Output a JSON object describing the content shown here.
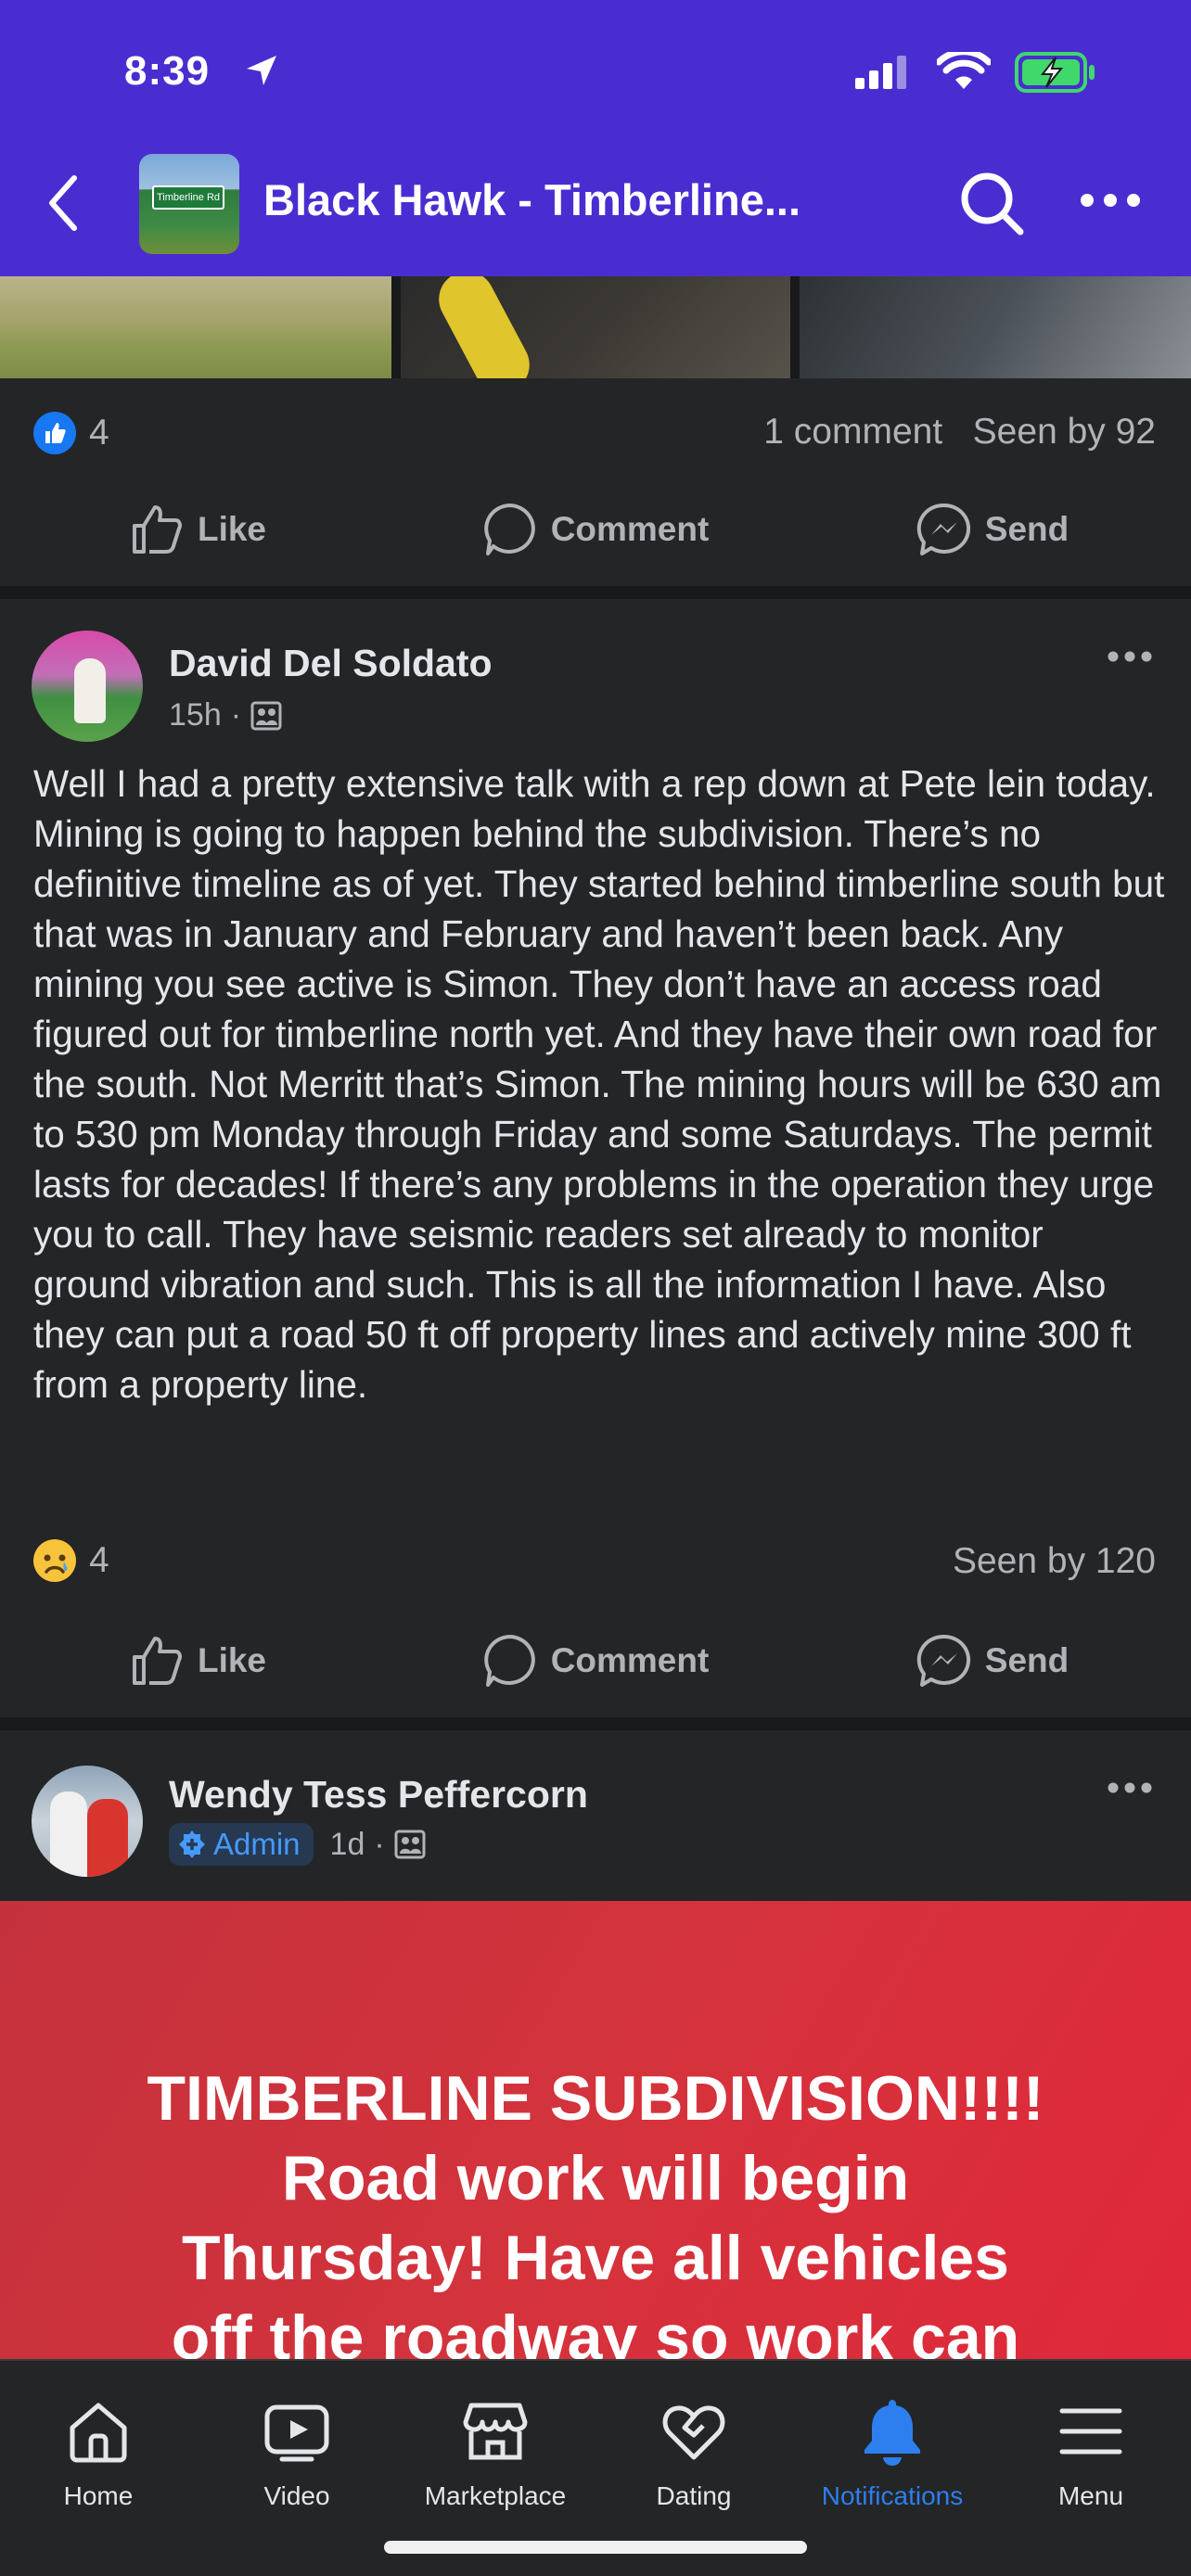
{
  "status_bar": {
    "time": "8:39"
  },
  "header": {
    "group_title": "Black Hawk - Timberline...",
    "thumb_text": "Timberline Rd"
  },
  "post1": {
    "like_count": "4",
    "comments": "1 comment",
    "seen_by": "Seen by 92",
    "actions": {
      "like": "Like",
      "comment": "Comment",
      "send": "Send"
    }
  },
  "post2": {
    "author": "David Del Soldato",
    "time": "15h",
    "body": "Well I had a pretty extensive talk with a rep down at Pete lein today.  Mining is going to happen behind the subdivision.  There’s no definitive timeline as of yet.  They started behind timberline south but that was in January and February and haven’t been back.  Any mining you see active is Simon.  They don’t have an access road figured out for timberline north yet. And they have their own road for the south.  Not Merritt that’s Simon.  The mining hours will be 630 am to 530 pm Monday through Friday and some Saturdays.  The permit lasts for decades! If there’s any problems in the operation they urge you to call.   They have seismic readers set already to monitor ground vibration and such.  This is all the information I have.  Also they can put a road 50 ft off property lines and actively mine 300 ft from a property line.",
    "reaction_count": "4",
    "seen_by": "Seen by 120",
    "actions": {
      "like": "Like",
      "comment": "Comment",
      "send": "Send"
    }
  },
  "post3": {
    "author": "Wendy Tess Peffercorn",
    "badge": "Admin",
    "time": "1d",
    "banner_lines": [
      "TIMBERLINE SUBDIVISION!!!!",
      "Road work will begin",
      "Thursday! Have all vehicles",
      "off the roadway so work can"
    ]
  },
  "tabbar": {
    "tabs": [
      {
        "label": "Home",
        "icon": "home-icon"
      },
      {
        "label": "Video",
        "icon": "video-icon"
      },
      {
        "label": "Marketplace",
        "icon": "marketplace-icon"
      },
      {
        "label": "Dating",
        "icon": "dating-icon"
      },
      {
        "label": "Notifications",
        "icon": "bell-icon",
        "active": true
      },
      {
        "label": "Menu",
        "icon": "menu-icon"
      }
    ]
  },
  "colors": {
    "header": "#4a2dd1",
    "accent": "#2d7fef",
    "banner": "#d4333c"
  }
}
